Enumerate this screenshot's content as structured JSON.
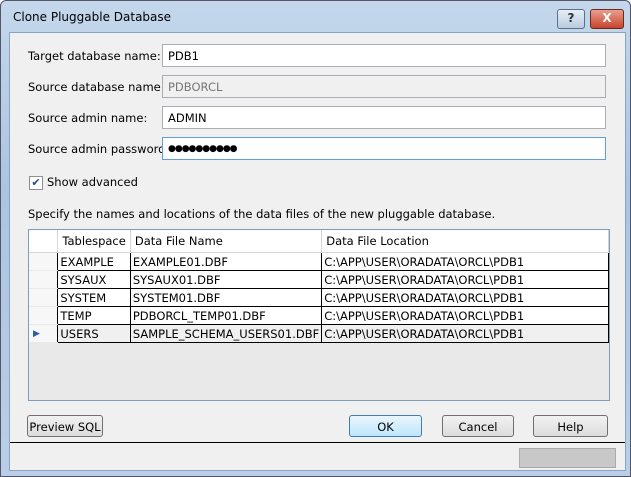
{
  "window": {
    "title": "Clone Pluggable Database",
    "help_label": "?",
    "close_label": "X"
  },
  "form": {
    "target_label": "Target database name:",
    "target_value": "PDB1",
    "source_label": "Source database name:",
    "source_value": "PDBORCL",
    "admin_label": "Source admin name:",
    "admin_value": "ADMIN",
    "password_label": "Source admin password:",
    "password_value": "●●●●●●●●●●",
    "show_advanced_label": "Show advanced",
    "show_advanced_checked": true
  },
  "grid": {
    "description": "Specify the names and locations of the data files of the new pluggable database.",
    "columns": [
      "Tablespace",
      "Data File Name",
      "Data File Location"
    ],
    "rows": [
      [
        "EXAMPLE",
        "EXAMPLE01.DBF",
        "C:\\APP\\USER\\ORADATA\\ORCL\\PDB1"
      ],
      [
        "SYSAUX",
        "SYSAUX01.DBF",
        "C:\\APP\\USER\\ORADATA\\ORCL\\PDB1"
      ],
      [
        "SYSTEM",
        "SYSTEM01.DBF",
        "C:\\APP\\USER\\ORADATA\\ORCL\\PDB1"
      ],
      [
        "TEMP",
        "PDBORCL_TEMP01.DBF",
        "C:\\APP\\USER\\ORADATA\\ORCL\\PDB1"
      ],
      [
        "USERS",
        "SAMPLE_SCHEMA_USERS01.DBF",
        "C:\\APP\\USER\\ORADATA\\ORCL\\PDB1"
      ]
    ],
    "current_row_marker": "▶"
  },
  "buttons": {
    "preview": "Preview SQL",
    "ok": "OK",
    "cancel": "Cancel",
    "help": "Help"
  }
}
